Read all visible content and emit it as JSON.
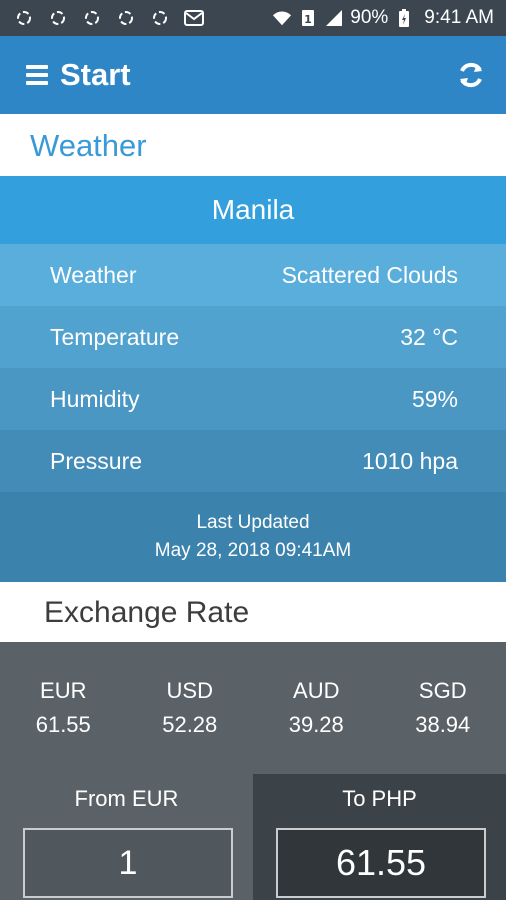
{
  "status_bar": {
    "battery": "90%",
    "time": "9:41 AM",
    "notification_icons": [
      "sync-icon",
      "sync-icon",
      "sync-icon",
      "sync-icon",
      "sync-icon",
      "mail-icon"
    ]
  },
  "app_bar": {
    "title": "Start"
  },
  "weather": {
    "section_title": "Weather",
    "city": "Manila",
    "rows": [
      {
        "label": "Weather",
        "value": "Scattered Clouds"
      },
      {
        "label": "Temperature",
        "value": "32 °C"
      },
      {
        "label": "Humidity",
        "value": "59%"
      },
      {
        "label": "Pressure",
        "value": "1010 hpa"
      }
    ],
    "last_updated_label": "Last Updated",
    "last_updated_value": "May 28, 2018 09:41AM"
  },
  "exchange": {
    "section_title": "Exchange Rate",
    "rates": [
      {
        "code": "EUR",
        "value": "61.55"
      },
      {
        "code": "USD",
        "value": "52.28"
      },
      {
        "code": "AUD",
        "value": "39.28"
      },
      {
        "code": "SGD",
        "value": "38.94"
      }
    ],
    "converter": {
      "from_label": "From EUR",
      "from_value": "1",
      "to_label": "To PHP",
      "to_value": "61.55"
    }
  },
  "colors": {
    "app_bar": "#2f86c6",
    "accent": "#3a9ad8",
    "status_bar": "#3c4651"
  }
}
